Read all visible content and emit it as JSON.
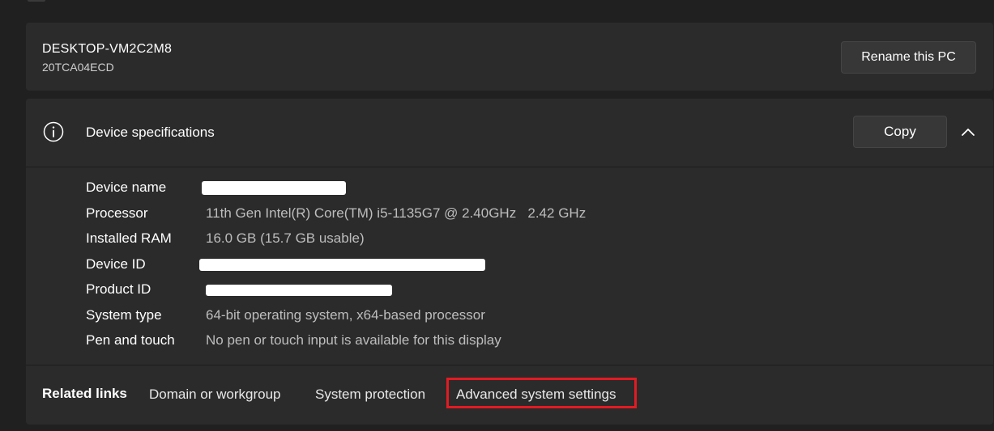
{
  "pc": {
    "name": "DESKTOP-VM2C2M8",
    "model": "20TCA04ECD",
    "rename_label": "Rename this PC"
  },
  "specs": {
    "title": "Device specifications",
    "copy_label": "Copy",
    "rows": [
      {
        "label": "Device name",
        "value": "",
        "redacted": true
      },
      {
        "label": "Processor",
        "value": "11th Gen Intel(R) Core(TM) i5-1135G7 @ 2.40GHz   2.42 GHz"
      },
      {
        "label": "Installed RAM",
        "value": "16.0 GB (15.7 GB usable)"
      },
      {
        "label": "Device ID",
        "value": "",
        "redacted": true
      },
      {
        "label": "Product ID",
        "value": "",
        "redacted": true
      },
      {
        "label": "System type",
        "value": "64-bit operating system, x64-based processor"
      },
      {
        "label": "Pen and touch",
        "value": "No pen or touch input is available for this display"
      }
    ]
  },
  "related_links": {
    "title": "Related links",
    "items": [
      "Domain or workgroup",
      "System protection",
      "Advanced system settings"
    ]
  },
  "colors": {
    "background": "#202020",
    "card": "#2b2b2b",
    "highlight": "#e21b23"
  }
}
